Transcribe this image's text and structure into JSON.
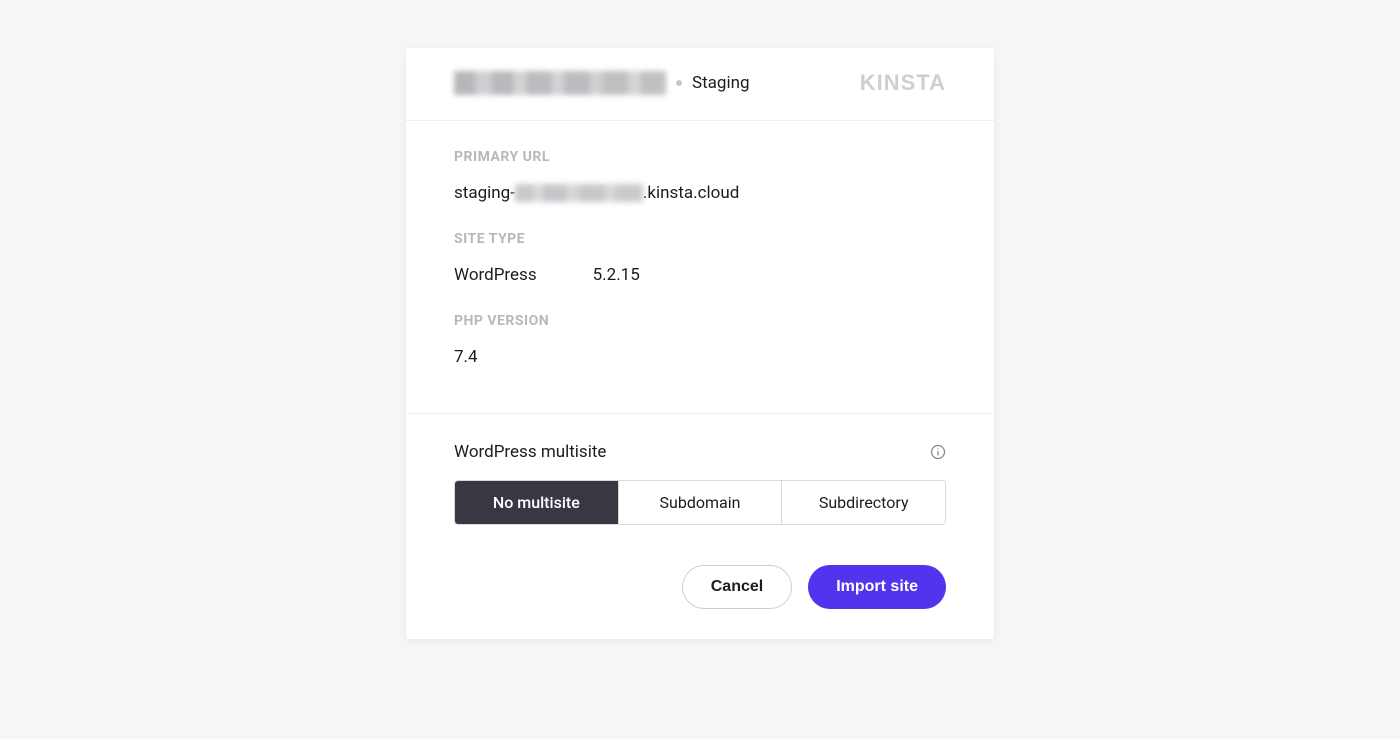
{
  "header": {
    "environment_label": "Staging",
    "logo_text": "KINSTA"
  },
  "info": {
    "primary_url_label": "PRIMARY URL",
    "primary_url_prefix": "staging-",
    "primary_url_suffix": ".kinsta.cloud",
    "site_type_label": "SITE TYPE",
    "site_type_name": "WordPress",
    "site_type_version": "5.2.15",
    "php_version_label": "PHP VERSION",
    "php_version_value": "7.4"
  },
  "multisite": {
    "label": "WordPress multisite",
    "options": {
      "none": "No multisite",
      "subdomain": "Subdomain",
      "subdirectory": "Subdirectory"
    },
    "selected": "none"
  },
  "actions": {
    "cancel": "Cancel",
    "import": "Import site"
  }
}
